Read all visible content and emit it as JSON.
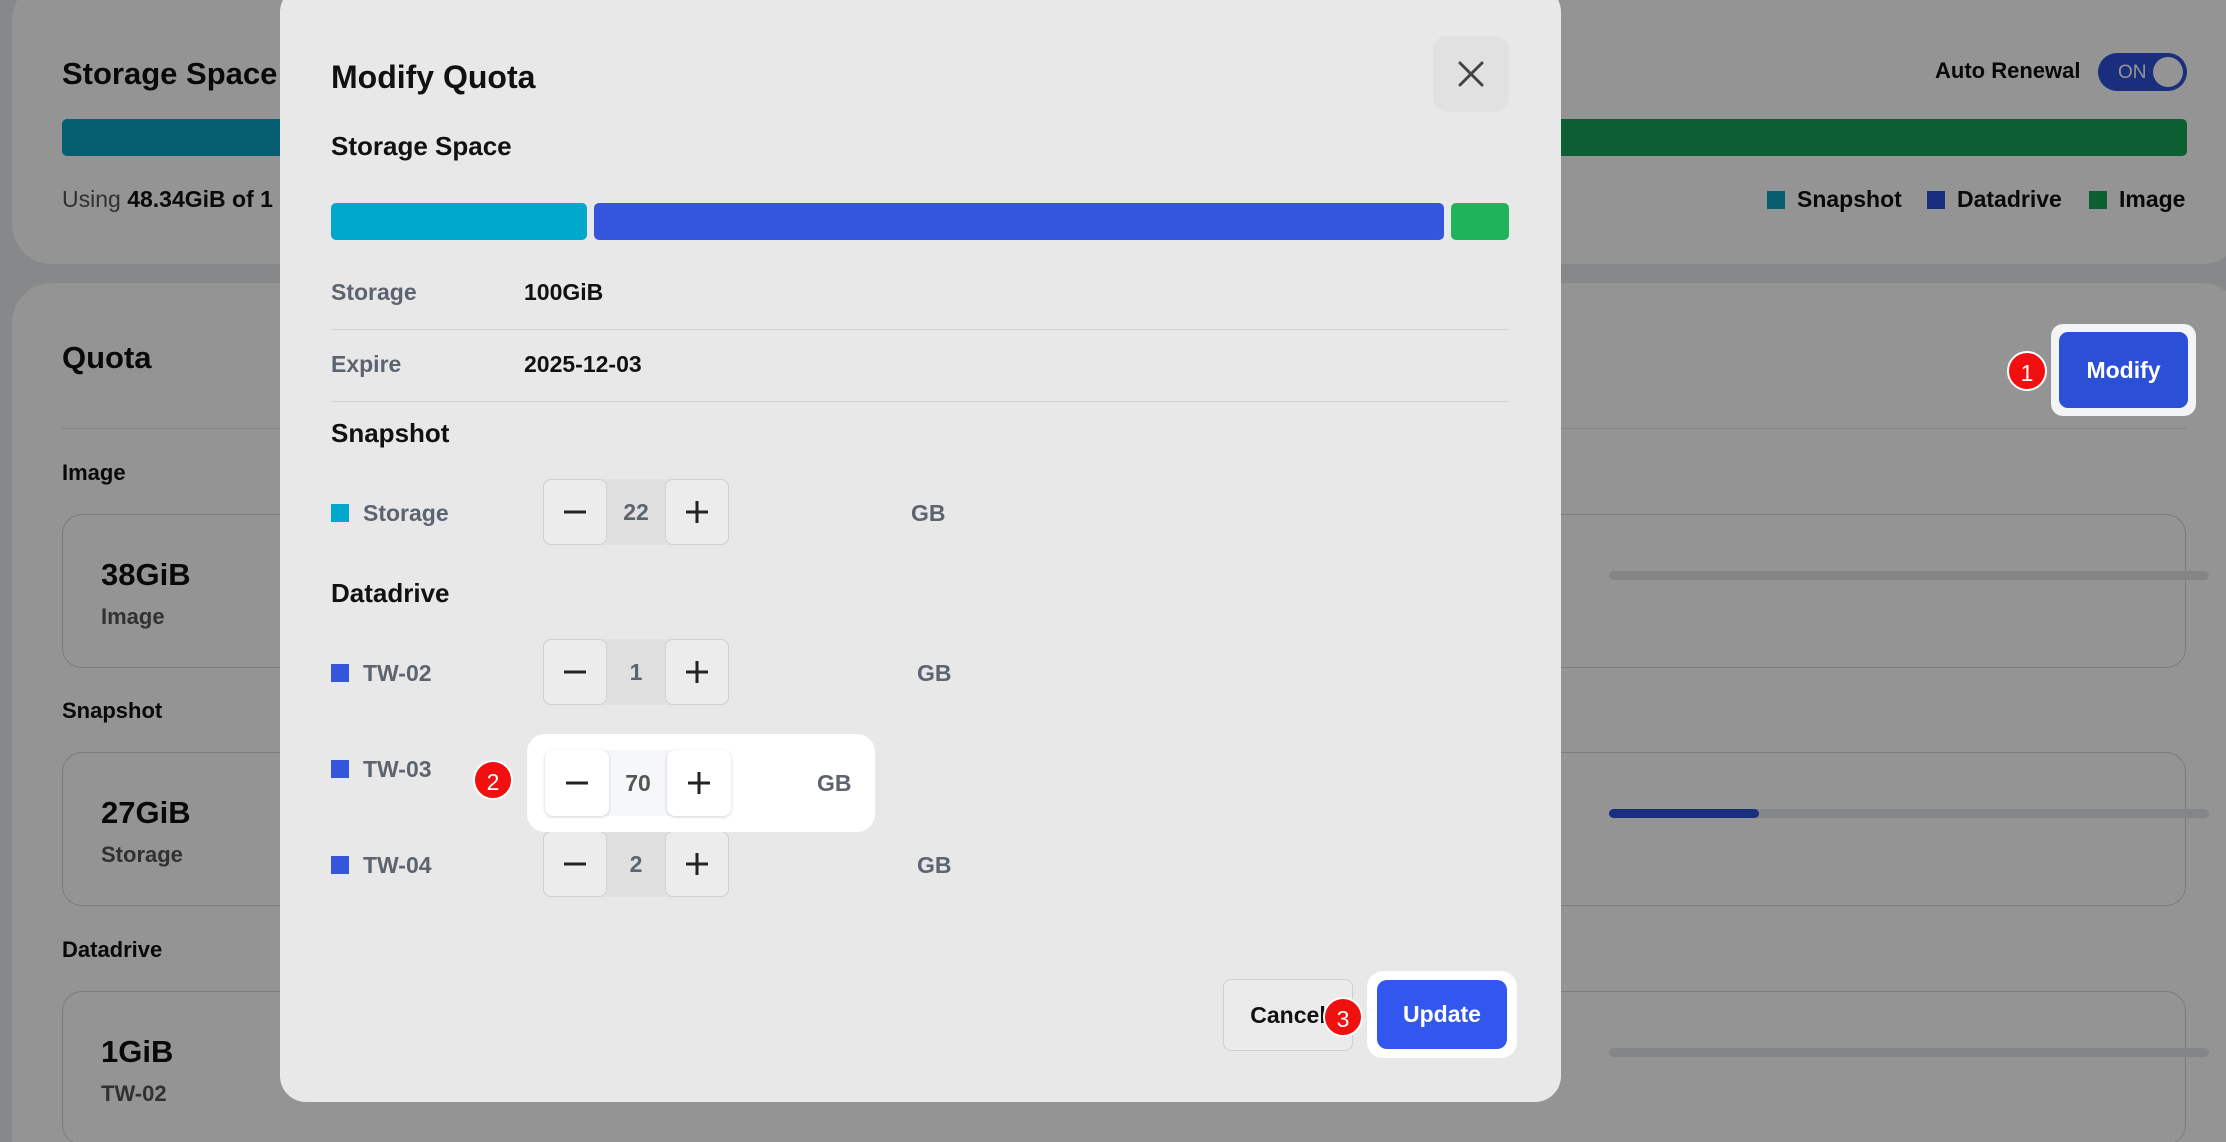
{
  "background": {
    "storage_space_title": "Storage Space",
    "using_prefix": "Using",
    "using_amount": "48.34GiB",
    "using_of": "of 1",
    "auto_renewal_label": "Auto Renewal",
    "auto_renewal_state": "ON",
    "legend": [
      {
        "label": "Snapshot",
        "color": "#0aa3bf"
      },
      {
        "label": "Datadrive",
        "color": "#2b50d6"
      },
      {
        "label": "Image",
        "color": "#15a459"
      }
    ],
    "quota_title": "Quota",
    "modify_label": "Modify",
    "sections": [
      {
        "label": "Image",
        "value": "38GiB",
        "name": "Image",
        "progress": 0
      },
      {
        "label": "Snapshot",
        "value": "27GiB",
        "name": "Storage",
        "progress": 0.25
      },
      {
        "label": "Datadrive",
        "value": "1GiB",
        "name": "TW-02",
        "progress": 0
      }
    ]
  },
  "modal": {
    "title": "Modify Quota",
    "close_icon": "close-icon",
    "storage_space_title": "Storage Space",
    "bar_colors": {
      "snapshot": "#00a8cc",
      "datadrive": "#3356dd",
      "image": "#1fb35c"
    },
    "info": [
      {
        "label": "Storage",
        "value": "100GiB"
      },
      {
        "label": "Expire",
        "value": "2025-12-03"
      }
    ],
    "snapshot_title": "Snapshot",
    "snapshot_rows": [
      {
        "label": "Storage",
        "value": "22",
        "unit": "GB",
        "color": "#00a8cc"
      }
    ],
    "datadrive_title": "Datadrive",
    "datadrive_rows": [
      {
        "label": "TW-02",
        "value": "1",
        "unit": "GB",
        "color": "#3356dd"
      },
      {
        "label": "TW-03",
        "value": "70",
        "unit": "GB",
        "color": "#3356dd"
      },
      {
        "label": "TW-04",
        "value": "2",
        "unit": "GB",
        "color": "#3356dd"
      }
    ],
    "cancel_label": "Cancel",
    "update_label": "Update"
  },
  "annotations": [
    "1",
    "2",
    "3"
  ]
}
